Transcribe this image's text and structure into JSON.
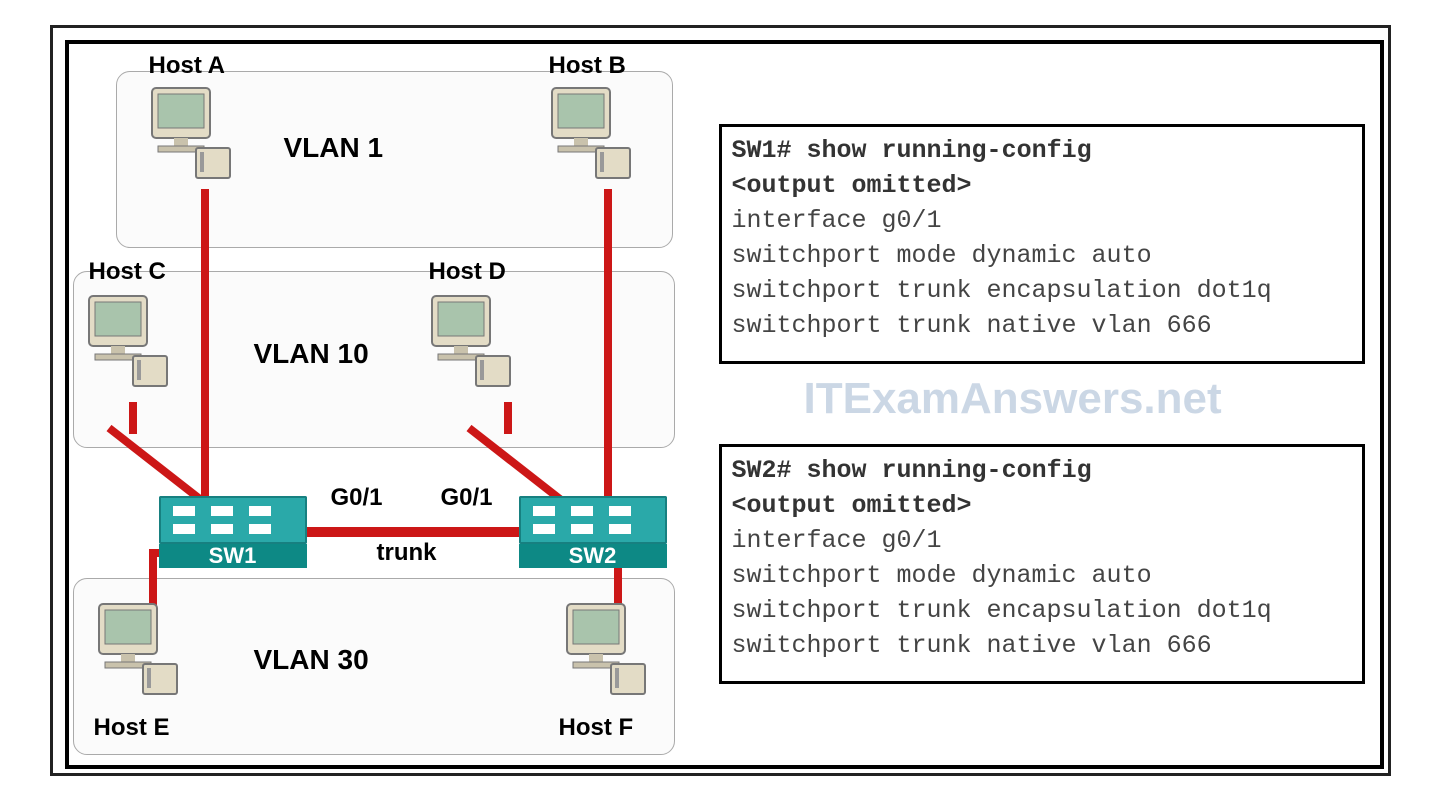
{
  "hosts": {
    "a": "Host A",
    "b": "Host B",
    "c": "Host C",
    "d": "Host D",
    "e": "Host E",
    "f": "Host F"
  },
  "vlans": {
    "top": "VLAN 1",
    "middle": "VLAN 10",
    "bottom": "VLAN 30"
  },
  "switches": {
    "left": "SW1",
    "right": "SW2"
  },
  "ports": {
    "sw1_g01": "G0/1",
    "sw2_g01": "G0/1"
  },
  "trunk_label": "trunk",
  "config_sw1": {
    "prompt": "SW1#",
    "cmd": "show running-config",
    "omit": "<output omitted>",
    "lines": [
      "interface g0/1",
      "switchport mode dynamic auto",
      "switchport trunk encapsulation dot1q",
      "switchport trunk native vlan 666"
    ]
  },
  "config_sw2": {
    "prompt": "SW2#",
    "cmd": "show running-config",
    "omit": "<output omitted>",
    "lines": [
      "interface g0/1",
      "switchport mode dynamic auto",
      "switchport trunk encapsulation dot1q",
      "switchport trunk native vlan 666"
    ]
  },
  "watermark": "ITExamAnswers.net",
  "chart_data": {
    "type": "diagram",
    "nodes": [
      {
        "id": "HostA",
        "vlan": 1
      },
      {
        "id": "HostB",
        "vlan": 1
      },
      {
        "id": "HostC",
        "vlan": 10
      },
      {
        "id": "HostD",
        "vlan": 10
      },
      {
        "id": "HostE",
        "vlan": 30
      },
      {
        "id": "HostF",
        "vlan": 30
      },
      {
        "id": "SW1",
        "type": "switch"
      },
      {
        "id": "SW2",
        "type": "switch"
      }
    ],
    "edges": [
      {
        "from": "HostA",
        "to": "SW1"
      },
      {
        "from": "HostC",
        "to": "SW1"
      },
      {
        "from": "HostE",
        "to": "SW1"
      },
      {
        "from": "HostB",
        "to": "SW2"
      },
      {
        "from": "HostD",
        "to": "SW2"
      },
      {
        "from": "HostF",
        "to": "SW2"
      },
      {
        "from": "SW1",
        "to": "SW2",
        "port_from": "G0/1",
        "port_to": "G0/1",
        "type": "trunk"
      }
    ],
    "switch_config": {
      "SW1": {
        "g0/1": {
          "mode": "dynamic auto",
          "encapsulation": "dot1q",
          "native_vlan": 666
        }
      },
      "SW2": {
        "g0/1": {
          "mode": "dynamic auto",
          "encapsulation": "dot1q",
          "native_vlan": 666
        }
      }
    }
  }
}
